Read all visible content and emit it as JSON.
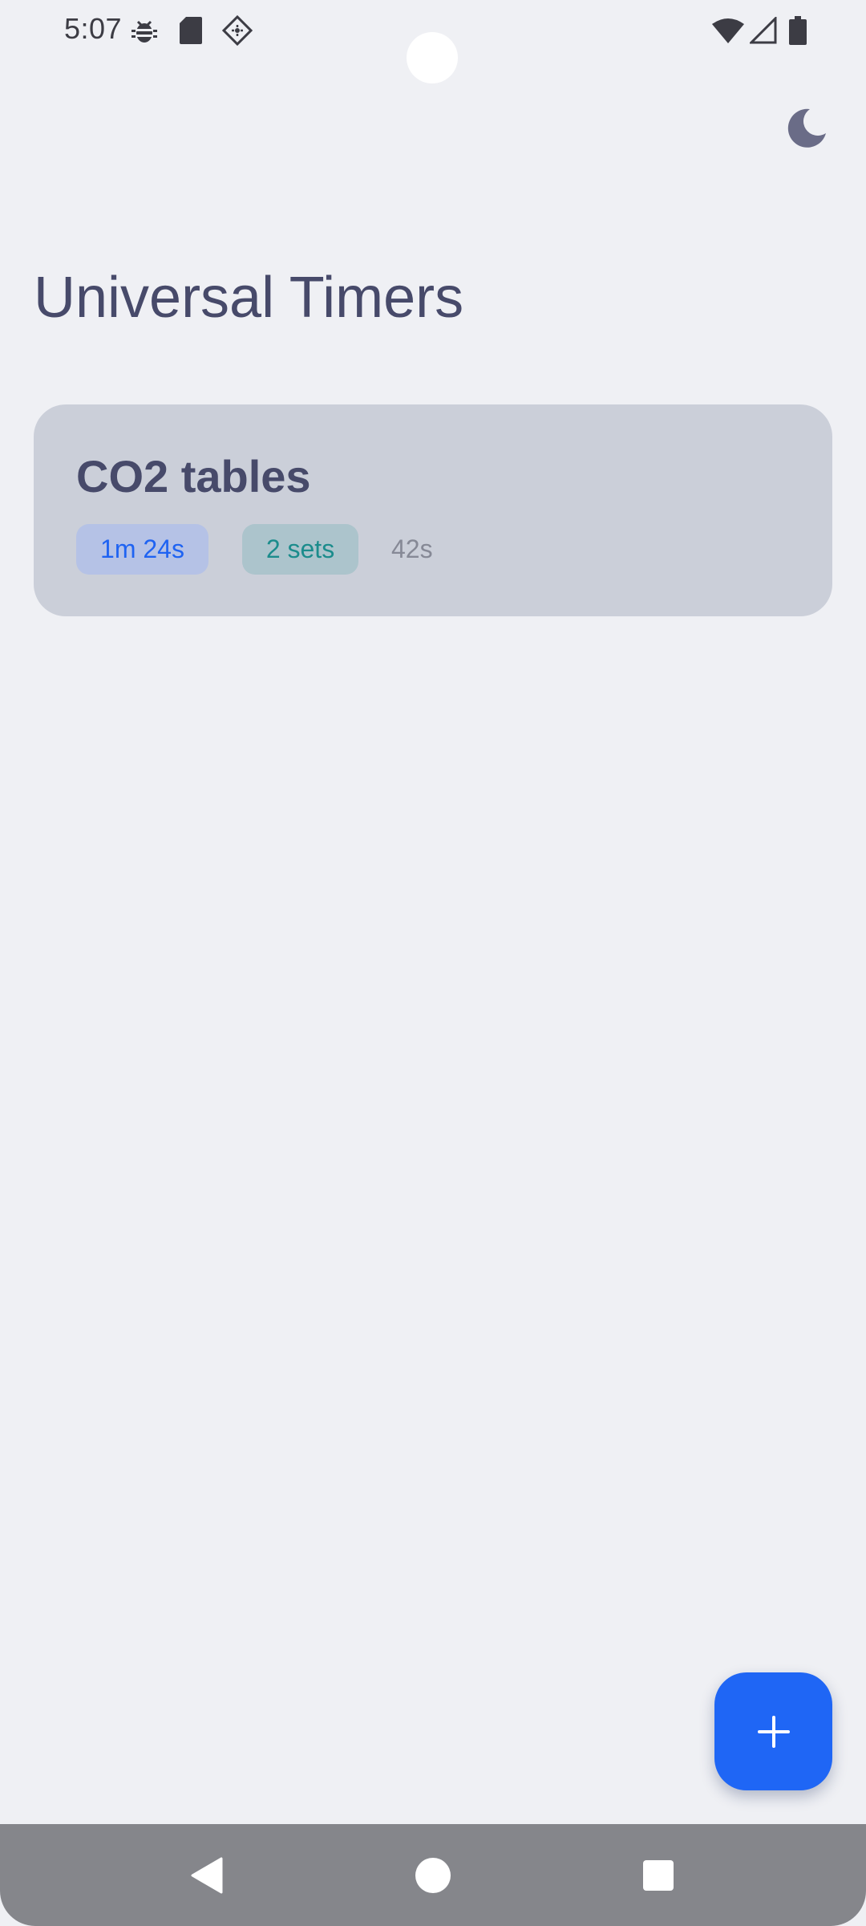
{
  "status_bar": {
    "time": "5:07",
    "left_icons": [
      "bug-icon",
      "sd-card-icon",
      "location-diamond-icon"
    ],
    "right_icons": [
      "wifi-icon",
      "cell-signal-icon",
      "battery-icon"
    ]
  },
  "header": {
    "theme_toggle_icon": "moon-icon"
  },
  "page_title": "Universal Timers",
  "timers": [
    {
      "name": "CO2 tables",
      "duration": "1m 24s",
      "sets": "2 sets",
      "rest": "42s"
    }
  ],
  "fab": {
    "icon": "plus-icon"
  },
  "nav_bar": {
    "icons": [
      "back-icon",
      "home-icon",
      "recents-icon"
    ]
  },
  "colors": {
    "background": "#eff0f4",
    "title": "#474a6a",
    "card": "#cbcfd9",
    "accent_blue": "#1f66f5",
    "chip_duration_bg": "#b5c2e6",
    "chip_duration_text": "#1f63f2",
    "chip_sets_bg": "#acc4cc",
    "chip_sets_text": "#1b8c8c",
    "nav_bar": "#85868b"
  }
}
